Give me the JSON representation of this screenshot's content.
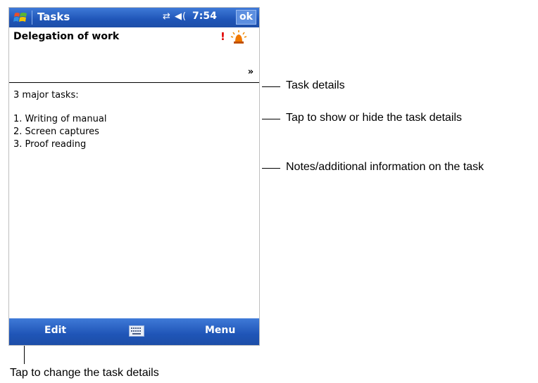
{
  "device": {
    "title_bar": {
      "app_title": "Tasks",
      "time": "7:54",
      "ok_label": "ok",
      "icons": [
        "start-menu-icon",
        "connectivity-icon",
        "volume-icon"
      ]
    },
    "task": {
      "name": "Delegation of work",
      "priority_mark": "!",
      "reminder_icon": "alarm-bell-icon",
      "expand_glyph": "»"
    },
    "notes": {
      "heading": "3 major tasks:",
      "items": [
        "1. Writing of manual",
        "2. Screen captures",
        "3. Proof reading"
      ]
    },
    "command_bar": {
      "edit_label": "Edit",
      "menu_label": "Menu",
      "keyboard_icon": "keyboard-icon"
    }
  },
  "callouts": {
    "task_details": "Task details",
    "toggle_details": "Tap to show or hide the task details",
    "notes_info": "Notes/additional information on the task",
    "change_details": "Tap to change the task details"
  },
  "colors": {
    "bar_blue": "#1f55b7",
    "priority_red": "#e00000"
  }
}
